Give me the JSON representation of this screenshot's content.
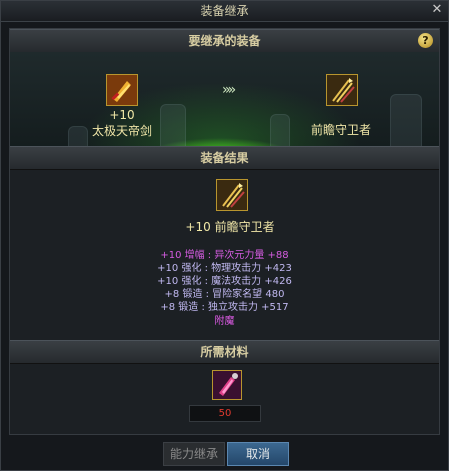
{
  "window": {
    "title": "装备继承",
    "close_glyph": "✕"
  },
  "inherit_section": {
    "header": "要继承的装备",
    "help_glyph": "?",
    "source_item": {
      "plus": "+10",
      "name": "太极天帝剑",
      "icon": "sword-icon"
    },
    "arrow_glyph": "»»",
    "target_item": {
      "name": "前瞻守卫者",
      "icon": "arrows-icon"
    }
  },
  "result_section": {
    "header": "装备结果",
    "item": {
      "plus": "+10",
      "name": "前瞻守卫者",
      "icon": "arrows-icon"
    },
    "stats": [
      {
        "text": "+10 增幅 : 异次元力量 +88",
        "color": "#d45ce0"
      },
      {
        "text": "+10 强化 : 物理攻击力 +423",
        "color": "#c0b8f0"
      },
      {
        "text": "+10 强化 : 魔法攻击力 +426",
        "color": "#c0b8f0"
      },
      {
        "text": "+8 锻造 : 冒险家名望 480",
        "color": "#c0b8f0"
      },
      {
        "text": "+8 锻造 : 独立攻击力 +517",
        "color": "#c0b8f0"
      },
      {
        "text": "附魔",
        "color": "#e05ce8"
      }
    ]
  },
  "materials_section": {
    "header": "所需材料",
    "material": {
      "icon": "crystal-icon",
      "count": "50"
    }
  },
  "buttons": {
    "inherit": "能力继承",
    "cancel": "取消"
  },
  "colors": {
    "accent_gold": "#b8952e",
    "count_red": "#e03a2f",
    "stat_purple": "#c0b8f0",
    "amplify_magenta": "#d45ce0"
  }
}
